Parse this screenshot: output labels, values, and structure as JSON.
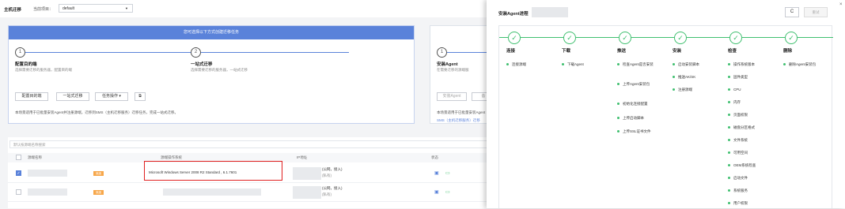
{
  "header": {
    "title": "主机迁移",
    "project_label": "当前项目：",
    "project_value": "default"
  },
  "wizard": {
    "banner": "您可选择以下方式创建迁移任务",
    "steps": [
      {
        "num": "1",
        "title": "配置目的端",
        "desc": "选择需要迁移的服务器，配置目的端"
      },
      {
        "num": "2",
        "title": "一站式迁移",
        "desc": "选择需要迁移的服务器，一站式迁移"
      }
    ],
    "buttons": {
      "config": "配置目的端",
      "onestop": "一站式迁移",
      "task_ops": "任务操作 ▾"
    },
    "desc": "本场景适用于已批量安装Agent并注册源端，迁移到SMS（主机迁移服务）迁移任务，完成一站式迁移。"
  },
  "wizard2": {
    "step_num": "1",
    "title": "安装Agent",
    "desc": "在需要迁移的源端服",
    "btn": "安装Agent",
    "btn2": "备",
    "desc1": "本场景适用于已批量安装Agent",
    "desc2": "SMS（主机迁移服务）迁移"
  },
  "table": {
    "search_placeholder": "默认按源端名称搜索",
    "headers": {
      "name": "源端名称",
      "os": "源端操作系统",
      "ip": "IP地址",
      "status": "状态"
    },
    "rows": [
      {
        "tag": "就绪",
        "os": "Microsoft Windows Server 2008 R2 Standard , 6.1.7601",
        "ip1": "(公网，接入)",
        "ip2": "(私有)",
        "checked": "✓"
      },
      {
        "tag": "就绪",
        "os": "",
        "ip1": "(公网，接入)",
        "ip2": "(私有)",
        "checked": ""
      }
    ]
  },
  "drawer": {
    "title": "安装Agent进程",
    "refresh": "C",
    "retry": "重试",
    "close": "×",
    "columns": [
      {
        "title": "连接",
        "items": [
          "连接源端"
        ]
      },
      {
        "title": "下载",
        "items": [
          "下载Agent"
        ]
      },
      {
        "title": "推送",
        "items": [
          "检查Agent是否安装",
          "上传Agent安装包",
          "初始化连接配置",
          "上传启动脚本",
          "上传SSL证书文件"
        ]
      },
      {
        "title": "安装",
        "items": [
          "启动安装脚本",
          "推送AK/SK",
          "注册源端"
        ]
      },
      {
        "title": "检查",
        "items": [
          "操作系统版本",
          "固件类型",
          "CPU",
          "内存",
          "页面权限",
          "磁盘分区格式",
          "文件系统",
          "可用空间",
          "OEM系统检查",
          "启动文件",
          "系统服务",
          "用户权限"
        ]
      },
      {
        "title": "删除",
        "items": [
          "删除Agent安装包"
        ]
      }
    ]
  },
  "colors": {
    "accent": "#5a82da",
    "success": "#3fbf6f",
    "warning": "#f7a74a",
    "error": "#e02020"
  }
}
